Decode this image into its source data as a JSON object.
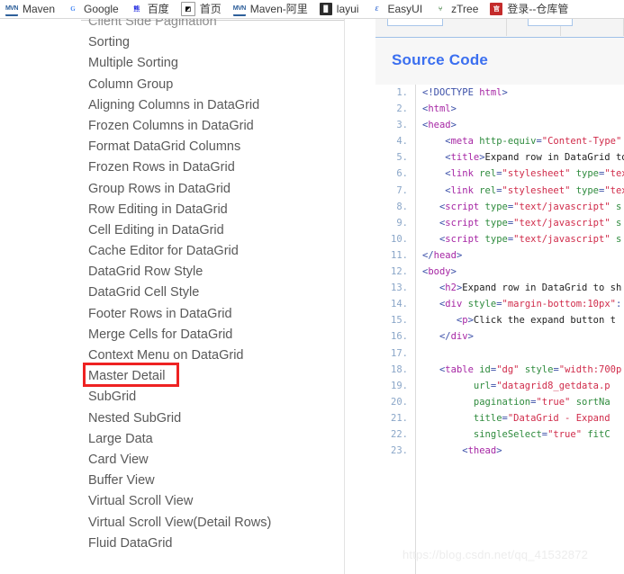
{
  "bookmarks": [
    {
      "icon": "maven-icon",
      "icon_glyph": "MVN",
      "label": "Maven"
    },
    {
      "icon": "google-icon",
      "icon_glyph": "G",
      "label": "Google"
    },
    {
      "icon": "baidu-icon",
      "icon_glyph": "熊",
      "label": "百度"
    },
    {
      "icon": "homepage-icon",
      "icon_glyph": "◩",
      "label": "首页"
    },
    {
      "icon": "maven-ali-icon",
      "icon_glyph": "MVN",
      "label": "Maven-阿里"
    },
    {
      "icon": "layui-icon",
      "icon_glyph": "▐▌",
      "label": "layui"
    },
    {
      "icon": "easyui-icon",
      "icon_glyph": "Ɛ",
      "label": "EasyUI"
    },
    {
      "icon": "ztree-icon",
      "icon_glyph": "⑂",
      "label": "zTree"
    },
    {
      "icon": "login-icon",
      "icon_glyph": "官",
      "label": "登录--仓库管"
    }
  ],
  "sidebar": {
    "items": [
      "Client Side Pagination",
      "Sorting",
      "Multiple Sorting",
      "Column Group",
      "Aligning Columns in DataGrid",
      "Frozen Columns in DataGrid",
      "Format DataGrid Columns",
      "Frozen Rows in DataGrid",
      "Group Rows in DataGrid",
      "Row Editing in DataGrid",
      "Cell Editing in DataGrid",
      "Cache Editor for DataGrid",
      "DataGrid Row Style",
      "DataGrid Cell Style",
      "Footer Rows in DataGrid",
      "Merge Cells for DataGrid",
      "Context Menu on DataGrid",
      "Master Detail",
      "SubGrid",
      "Nested SubGrid",
      "Large Data",
      "Card View",
      "Buffer View",
      "Virtual Scroll View",
      "Virtual Scroll View(Detail Rows)",
      "Fluid DataGrid"
    ],
    "highlighted_item": "Master Detail",
    "highlight_color": "#ee2222"
  },
  "content": {
    "panel_title": "Source Code",
    "panel_title_color": "#3b6ff0",
    "code_lines": [
      {
        "n": "1.",
        "tokens": [
          {
            "t": "punc",
            "s": "<!DOCTYPE "
          },
          {
            "t": "tag",
            "s": "html"
          },
          {
            "t": "punc",
            "s": ">"
          }
        ]
      },
      {
        "n": "2.",
        "tokens": [
          {
            "t": "punc",
            "s": "<"
          },
          {
            "t": "tag",
            "s": "html"
          },
          {
            "t": "punc",
            "s": ">"
          }
        ]
      },
      {
        "n": "3.",
        "tokens": [
          {
            "t": "punc",
            "s": "<"
          },
          {
            "t": "tag",
            "s": "head"
          },
          {
            "t": "punc",
            "s": ">"
          }
        ]
      },
      {
        "n": "4.",
        "tokens": [
          {
            "t": "punc",
            "s": "    <"
          },
          {
            "t": "tag",
            "s": "meta"
          },
          {
            "t": "attr",
            "s": " http-equiv"
          },
          {
            "t": "punc",
            "s": "="
          },
          {
            "t": "val",
            "s": "\"Content-Type\""
          }
        ]
      },
      {
        "n": "5.",
        "tokens": [
          {
            "t": "punc",
            "s": "    <"
          },
          {
            "t": "tag",
            "s": "title"
          },
          {
            "t": "punc",
            "s": ">"
          },
          {
            "t": "text",
            "s": "Expand row in DataGrid to"
          }
        ]
      },
      {
        "n": "6.",
        "tokens": [
          {
            "t": "punc",
            "s": "    <"
          },
          {
            "t": "tag",
            "s": "link"
          },
          {
            "t": "attr",
            "s": " rel"
          },
          {
            "t": "punc",
            "s": "="
          },
          {
            "t": "val",
            "s": "\"stylesheet\""
          },
          {
            "t": "attr",
            "s": " type"
          },
          {
            "t": "punc",
            "s": "="
          },
          {
            "t": "val",
            "s": "\"tex"
          }
        ]
      },
      {
        "n": "7.",
        "tokens": [
          {
            "t": "punc",
            "s": "    <"
          },
          {
            "t": "tag",
            "s": "link"
          },
          {
            "t": "attr",
            "s": " rel"
          },
          {
            "t": "punc",
            "s": "="
          },
          {
            "t": "val",
            "s": "\"stylesheet\""
          },
          {
            "t": "attr",
            "s": " type"
          },
          {
            "t": "punc",
            "s": "="
          },
          {
            "t": "val",
            "s": "\"tex"
          }
        ]
      },
      {
        "n": "8.",
        "tokens": [
          {
            "t": "punc",
            "s": "   <"
          },
          {
            "t": "tag",
            "s": "script"
          },
          {
            "t": "attr",
            "s": " type"
          },
          {
            "t": "punc",
            "s": "="
          },
          {
            "t": "val",
            "s": "\"text/javascript\""
          },
          {
            "t": "attr",
            "s": " s"
          }
        ]
      },
      {
        "n": "9.",
        "tokens": [
          {
            "t": "punc",
            "s": "   <"
          },
          {
            "t": "tag",
            "s": "script"
          },
          {
            "t": "attr",
            "s": " type"
          },
          {
            "t": "punc",
            "s": "="
          },
          {
            "t": "val",
            "s": "\"text/javascript\""
          },
          {
            "t": "attr",
            "s": " s"
          }
        ]
      },
      {
        "n": "10.",
        "tokens": [
          {
            "t": "punc",
            "s": "   <"
          },
          {
            "t": "tag",
            "s": "script"
          },
          {
            "t": "attr",
            "s": " type"
          },
          {
            "t": "punc",
            "s": "="
          },
          {
            "t": "val",
            "s": "\"text/javascript\""
          },
          {
            "t": "attr",
            "s": " s"
          }
        ]
      },
      {
        "n": "11.",
        "tokens": [
          {
            "t": "punc",
            "s": "</"
          },
          {
            "t": "tag",
            "s": "head"
          },
          {
            "t": "punc",
            "s": ">"
          }
        ]
      },
      {
        "n": "12.",
        "tokens": [
          {
            "t": "punc",
            "s": "<"
          },
          {
            "t": "tag",
            "s": "body"
          },
          {
            "t": "punc",
            "s": ">"
          }
        ]
      },
      {
        "n": "13.",
        "tokens": [
          {
            "t": "punc",
            "s": "   <"
          },
          {
            "t": "tag",
            "s": "h2"
          },
          {
            "t": "punc",
            "s": ">"
          },
          {
            "t": "text",
            "s": "Expand row in DataGrid to sh"
          }
        ]
      },
      {
        "n": "14.",
        "tokens": [
          {
            "t": "punc",
            "s": "   <"
          },
          {
            "t": "tag",
            "s": "div"
          },
          {
            "t": "attr",
            "s": " style"
          },
          {
            "t": "punc",
            "s": "="
          },
          {
            "t": "val",
            "s": "\"margin-bottom:10px\""
          },
          {
            "t": "punc",
            "s": ":"
          }
        ]
      },
      {
        "n": "15.",
        "tokens": [
          {
            "t": "punc",
            "s": "      <"
          },
          {
            "t": "tag",
            "s": "p"
          },
          {
            "t": "punc",
            "s": ">"
          },
          {
            "t": "text",
            "s": "Click the expand button t"
          }
        ]
      },
      {
        "n": "16.",
        "tokens": [
          {
            "t": "punc",
            "s": "   </"
          },
          {
            "t": "tag",
            "s": "div"
          },
          {
            "t": "punc",
            "s": ">"
          }
        ]
      },
      {
        "n": "17.",
        "tokens": []
      },
      {
        "n": "18.",
        "tokens": [
          {
            "t": "punc",
            "s": "   <"
          },
          {
            "t": "tag",
            "s": "table"
          },
          {
            "t": "attr",
            "s": " id"
          },
          {
            "t": "punc",
            "s": "="
          },
          {
            "t": "val",
            "s": "\"dg\""
          },
          {
            "t": "attr",
            "s": " style"
          },
          {
            "t": "punc",
            "s": "="
          },
          {
            "t": "val",
            "s": "\"width:700p"
          }
        ]
      },
      {
        "n": "19.",
        "tokens": [
          {
            "t": "punc",
            "s": "         "
          },
          {
            "t": "attr",
            "s": "url"
          },
          {
            "t": "punc",
            "s": "="
          },
          {
            "t": "val",
            "s": "\"datagrid8_getdata.p"
          }
        ]
      },
      {
        "n": "20.",
        "tokens": [
          {
            "t": "punc",
            "s": "         "
          },
          {
            "t": "attr",
            "s": "pagination"
          },
          {
            "t": "punc",
            "s": "="
          },
          {
            "t": "val",
            "s": "\"true\""
          },
          {
            "t": "attr",
            "s": " sortNa"
          }
        ]
      },
      {
        "n": "21.",
        "tokens": [
          {
            "t": "punc",
            "s": "         "
          },
          {
            "t": "attr",
            "s": "title"
          },
          {
            "t": "punc",
            "s": "="
          },
          {
            "t": "val",
            "s": "\"DataGrid - Expand"
          }
        ]
      },
      {
        "n": "22.",
        "tokens": [
          {
            "t": "punc",
            "s": "         "
          },
          {
            "t": "attr",
            "s": "singleSelect"
          },
          {
            "t": "punc",
            "s": "="
          },
          {
            "t": "val",
            "s": "\"true\""
          },
          {
            "t": "attr",
            "s": " fitC"
          }
        ]
      },
      {
        "n": "23.",
        "tokens": [
          {
            "t": "punc",
            "s": "       <"
          },
          {
            "t": "tag",
            "s": "thead"
          },
          {
            "t": "punc",
            "s": ">"
          }
        ]
      }
    ]
  },
  "watermark": "https://blog.csdn.net/qq_41532872"
}
